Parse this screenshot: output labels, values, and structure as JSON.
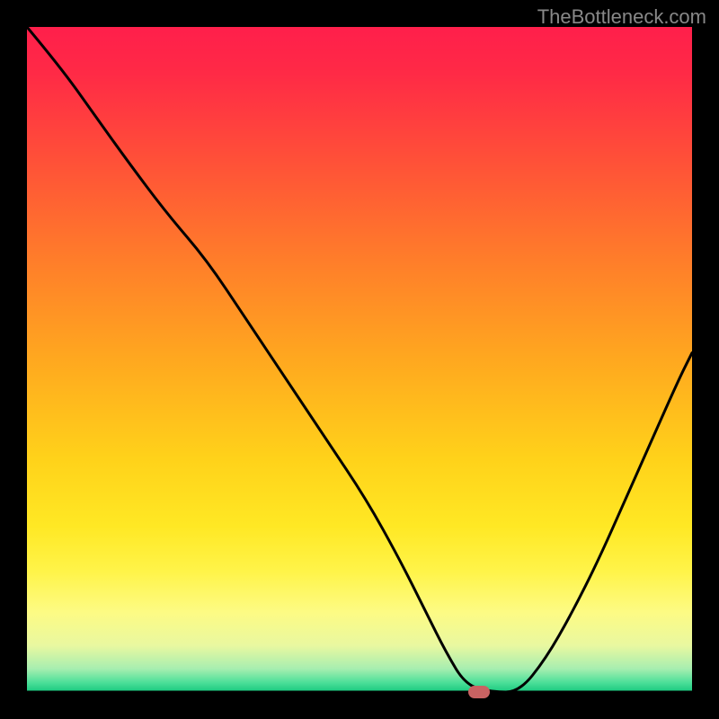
{
  "watermark": "TheBottleneck.com",
  "chart_data": {
    "type": "line",
    "title": "",
    "xlabel": "",
    "ylabel": "",
    "xlim": [
      0,
      100
    ],
    "ylim": [
      0,
      100
    ],
    "gradient_stops": [
      {
        "offset": 0.0,
        "color": "#ff1f4b"
      },
      {
        "offset": 0.07,
        "color": "#ff2a46"
      },
      {
        "offset": 0.2,
        "color": "#ff5038"
      },
      {
        "offset": 0.35,
        "color": "#ff7d2a"
      },
      {
        "offset": 0.5,
        "color": "#ffa81f"
      },
      {
        "offset": 0.65,
        "color": "#ffd21a"
      },
      {
        "offset": 0.75,
        "color": "#ffe824"
      },
      {
        "offset": 0.82,
        "color": "#fff44a"
      },
      {
        "offset": 0.88,
        "color": "#fdfb84"
      },
      {
        "offset": 0.93,
        "color": "#e9f8a0"
      },
      {
        "offset": 0.965,
        "color": "#a7eeb0"
      },
      {
        "offset": 0.985,
        "color": "#4fe09a"
      },
      {
        "offset": 1.0,
        "color": "#18c97e"
      }
    ],
    "series": [
      {
        "name": "bottleneck-curve",
        "color": "#000000",
        "x": [
          0,
          5,
          10,
          15,
          21,
          27,
          33,
          39,
          45,
          51,
          56,
          60,
          63,
          66,
          70,
          74,
          78,
          82,
          86,
          90,
          94,
          98,
          100
        ],
        "y": [
          100,
          94,
          87,
          80,
          72,
          65,
          56,
          47,
          38,
          29,
          20,
          12,
          6,
          1,
          0,
          0,
          5,
          12,
          20,
          29,
          38,
          47,
          51
        ]
      }
    ],
    "marker": {
      "x": 68,
      "y": 0,
      "color": "#c96262"
    },
    "baseline": {
      "y": 0,
      "color": "#000000"
    }
  }
}
